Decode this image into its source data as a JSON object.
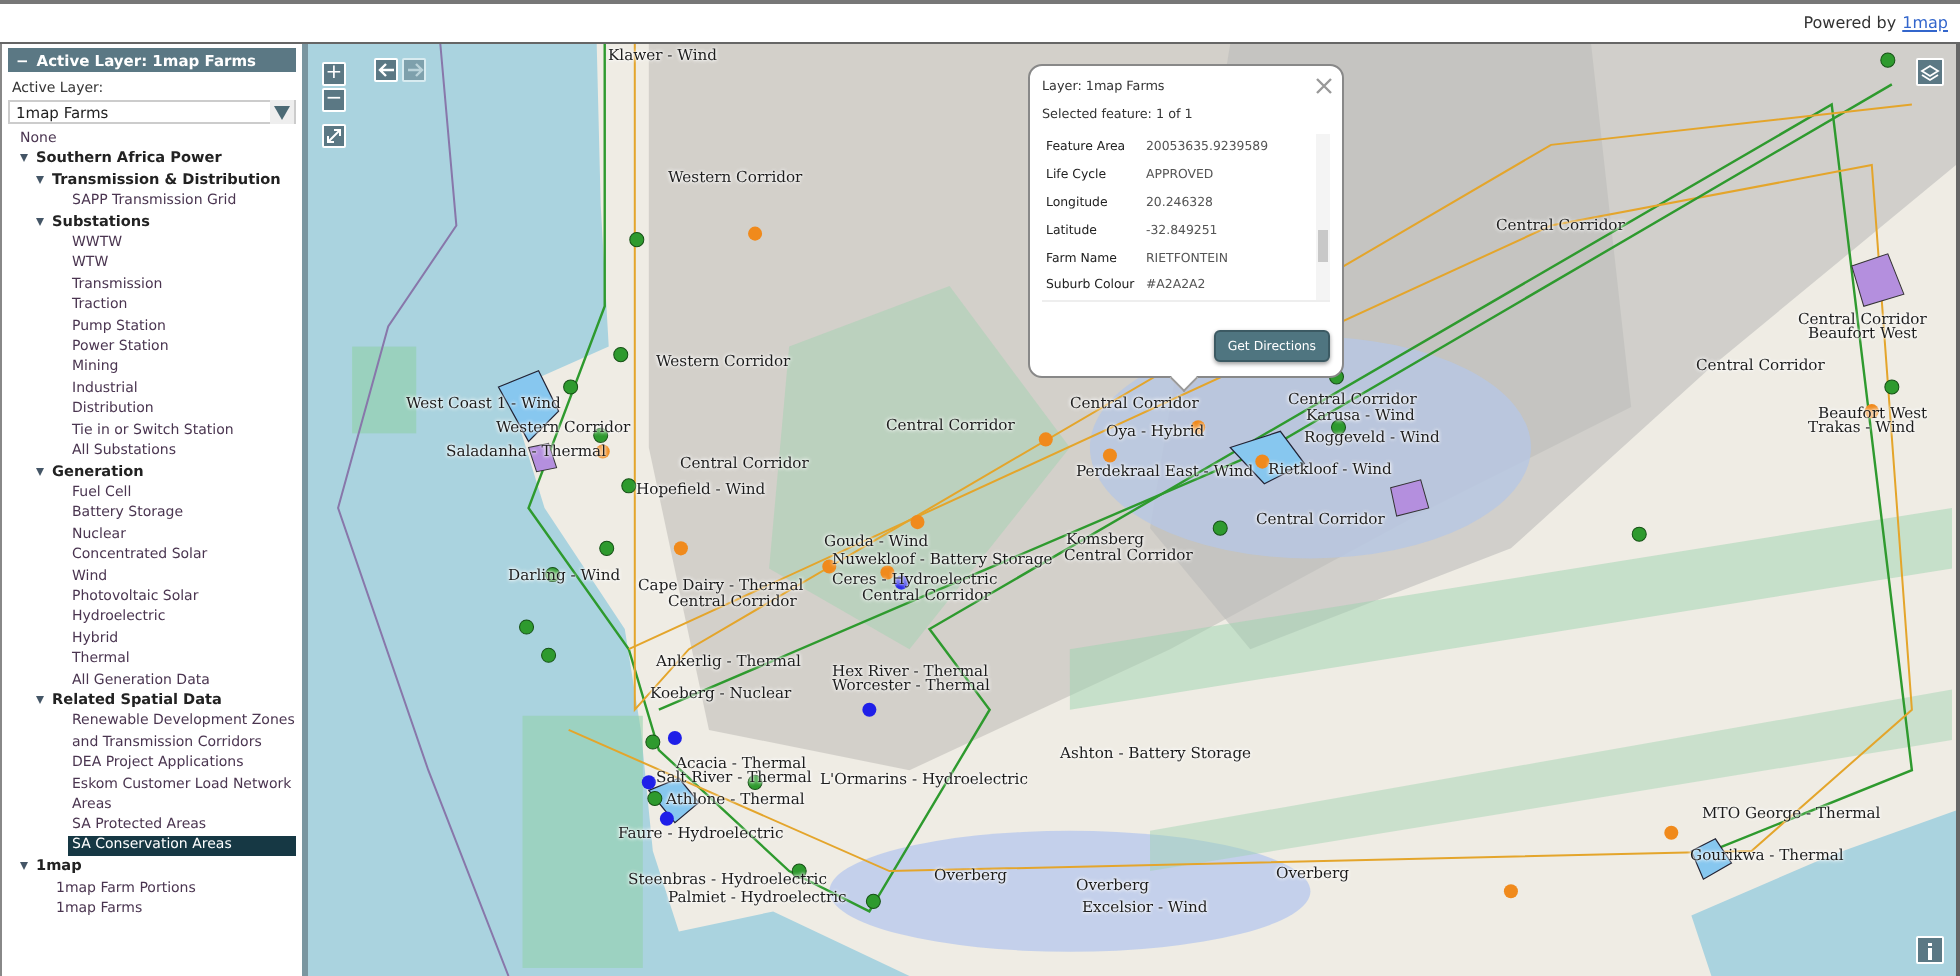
{
  "header": {
    "powered_by": "Powered by",
    "link": "1map"
  },
  "sidebar": {
    "toggle": "−",
    "title": "Active Layer: 1map Farms",
    "active_layer_label": "Active Layer:",
    "active_layer_value": "1map Farms",
    "tree": [
      {
        "label": "None",
        "selected": false
      },
      {
        "label": "Southern Africa Power",
        "selected": false,
        "expanded": true,
        "children": [
          {
            "label": "Transmission & Distribution",
            "selected": false,
            "expanded": true,
            "children": [
              {
                "label": "SAPP Transmission Grid",
                "selected": false
              }
            ]
          },
          {
            "label": "Substations",
            "selected": false,
            "expanded": true,
            "children": [
              {
                "label": "WWTW",
                "selected": false
              },
              {
                "label": "WTW",
                "selected": false
              },
              {
                "label": "Transmission",
                "selected": false
              },
              {
                "label": "Traction",
                "selected": false
              },
              {
                "label": "Pump Station",
                "selected": false
              },
              {
                "label": "Power Station",
                "selected": false
              },
              {
                "label": "Mining",
                "selected": false
              },
              {
                "label": "Industrial",
                "selected": false
              },
              {
                "label": "Distribution",
                "selected": false
              },
              {
                "label": "Tie in or Switch Station",
                "selected": false
              },
              {
                "label": "All Substations",
                "selected": false
              }
            ]
          },
          {
            "label": "Generation",
            "selected": false,
            "expanded": true,
            "children": [
              {
                "label": "Fuel Cell",
                "selected": false
              },
              {
                "label": "Battery Storage",
                "selected": false
              },
              {
                "label": "Nuclear",
                "selected": false
              },
              {
                "label": "Concentrated Solar",
                "selected": false
              },
              {
                "label": "Wind",
                "selected": false
              },
              {
                "label": "Photovoltaic Solar",
                "selected": false
              },
              {
                "label": "Hydroelectric",
                "selected": false
              },
              {
                "label": "Hybrid",
                "selected": false
              },
              {
                "label": "Thermal",
                "selected": false
              },
              {
                "label": "All Generation Data",
                "selected": false
              }
            ]
          },
          {
            "label": "Related Spatial Data",
            "selected": false,
            "expanded": true,
            "children": [
              {
                "label": "Renewable Development Zones and Transmission Corridors",
                "selected": false
              },
              {
                "label": "DEA Project Applications",
                "selected": false
              },
              {
                "label": "Eskom Customer Load Network Areas",
                "selected": false
              },
              {
                "label": "SA Protected Areas",
                "selected": false
              },
              {
                "label": "SA Conservation Areas",
                "selected": true
              }
            ]
          }
        ]
      },
      {
        "label": "1map",
        "selected": false,
        "expanded": true,
        "children": [
          {
            "label": "1map Farm Portions",
            "selected": false
          },
          {
            "label": "1map Farms",
            "selected": false
          }
        ]
      }
    ]
  },
  "map": {
    "zoom_in": "+",
    "zoom_out": "−",
    "back": {
      "disabled": false
    },
    "forward": {
      "disabled": true
    },
    "labels": [
      {
        "text": "Klawer - Wind"
      },
      {
        "text": "Western Corridor"
      },
      {
        "text": "Central Corridor"
      },
      {
        "text": "Central Corridor"
      },
      {
        "text": "Beaufort West"
      },
      {
        "text": "Western Corridor"
      },
      {
        "text": "Central Corridor"
      },
      {
        "text": "West Coast 1 - Wind"
      },
      {
        "text": "Central Corridor"
      },
      {
        "text": "Central Corridor"
      },
      {
        "text": "Karusa - Wind"
      },
      {
        "text": "Beaufort West"
      },
      {
        "text": "Western Corridor"
      },
      {
        "text": "Central Corridor"
      },
      {
        "text": "Oya - Hybrid"
      },
      {
        "text": "Roggeveld - Wind"
      },
      {
        "text": "Trakas - Wind"
      },
      {
        "text": "Saladanha - Thermal"
      },
      {
        "text": "Central Corridor"
      },
      {
        "text": "Perdekraal East - Wind"
      },
      {
        "text": "Rietkloof - Wind"
      },
      {
        "text": "Hopefield - Wind"
      },
      {
        "text": "Central Corridor"
      },
      {
        "text": "Gouda - Wind"
      },
      {
        "text": "Komsberg"
      },
      {
        "text": "Nuwekloof - Battery Storage"
      },
      {
        "text": "Central Corridor"
      },
      {
        "text": "Darling - Wind"
      },
      {
        "text": "Cape Dairy - Thermal"
      },
      {
        "text": "Ceres - Hydroelectric"
      },
      {
        "text": "Central Corridor"
      },
      {
        "text": "Central Corridor"
      },
      {
        "text": "Ankerlig - Thermal"
      },
      {
        "text": "Hex River - Thermal"
      },
      {
        "text": "Koeberg - Nuclear"
      },
      {
        "text": "Worcester - Thermal"
      },
      {
        "text": "Acacia - Thermal"
      },
      {
        "text": "Ashton - Battery Storage"
      },
      {
        "text": "Salt River - Thermal"
      },
      {
        "text": "L'Ormarins - Hydroelectric"
      },
      {
        "text": "Athlone - Thermal"
      },
      {
        "text": "MTO George - Thermal"
      },
      {
        "text": "Faure - Hydroelectric"
      },
      {
        "text": "Gourikwa - Thermal"
      },
      {
        "text": "Steenbras - Hydroelectric"
      },
      {
        "text": "Overberg"
      },
      {
        "text": "Overberg"
      },
      {
        "text": "Overberg"
      },
      {
        "text": "Palmiet - Hydroelectric"
      },
      {
        "text": "Excelsior - Wind"
      }
    ],
    "popup": {
      "layer": "Layer: 1map Farms",
      "selected_feature": "Selected feature: 1 of 1",
      "fields": [
        {
          "name": "Feature Area",
          "value": "20053635.9239589"
        },
        {
          "name": "Life Cycle",
          "value": "APPROVED"
        },
        {
          "name": "Longitude",
          "value": "20.246328"
        },
        {
          "name": "Latitude",
          "value": "-32.849251"
        },
        {
          "name": "Farm Name",
          "value": "RIETFONTEIN"
        },
        {
          "name": "Suburb Colour",
          "value": "#A2A2A2"
        }
      ],
      "button": "Get Directions"
    }
  }
}
